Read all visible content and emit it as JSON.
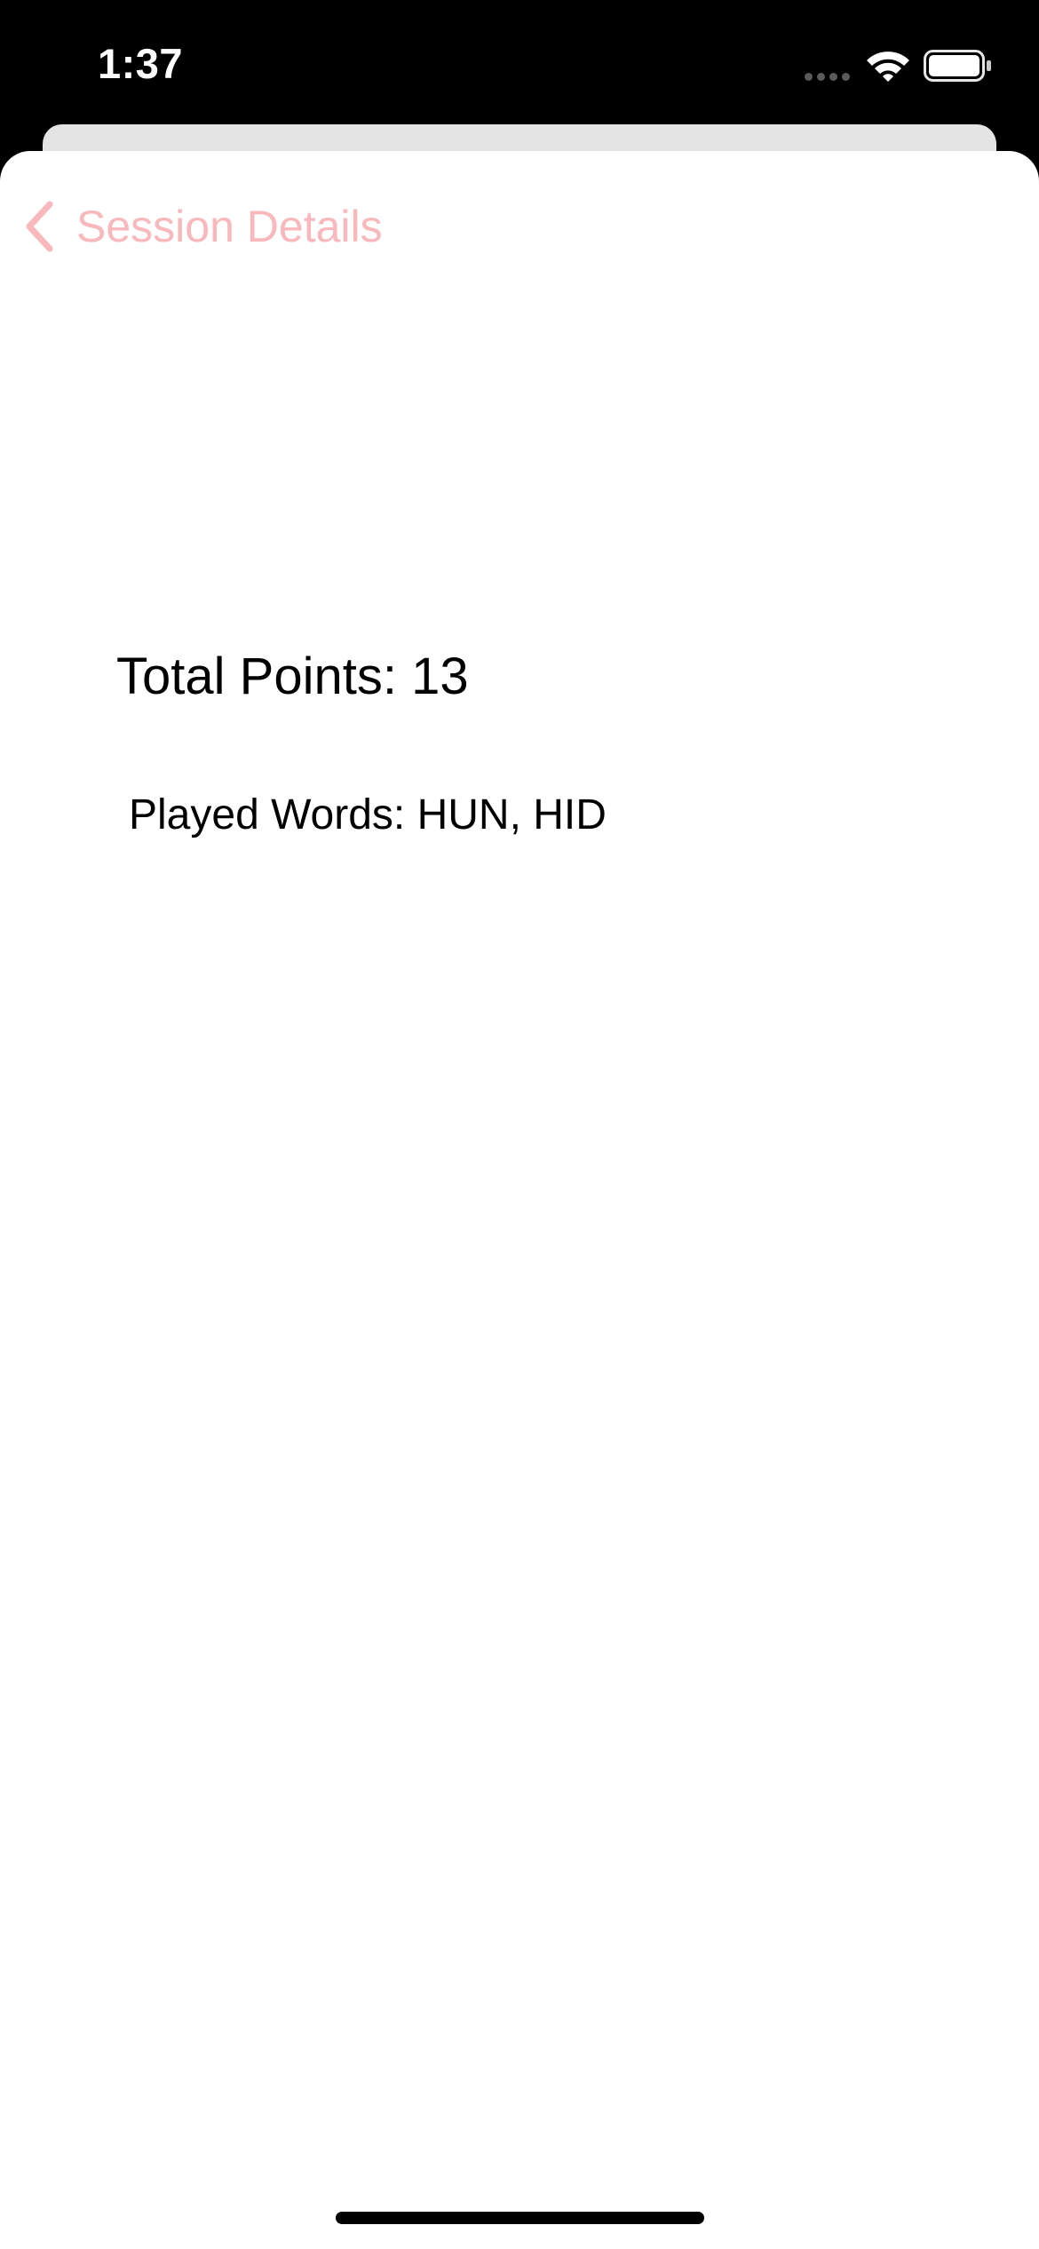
{
  "status_bar": {
    "time": "1:37"
  },
  "nav": {
    "back_label": "Session Details"
  },
  "content": {
    "total_points_label": "Total Points:",
    "total_points": "13",
    "played_words_label": "Played Words:",
    "played_words": "HUN, HID"
  },
  "colors": {
    "accent": "#f9b8bc",
    "background": "#ffffff",
    "status_bar_background": "#000000"
  },
  "icons": {
    "back": "chevron-left-icon",
    "signal": "cellular-signal-icon",
    "wifi": "wifi-icon",
    "battery": "battery-icon"
  }
}
